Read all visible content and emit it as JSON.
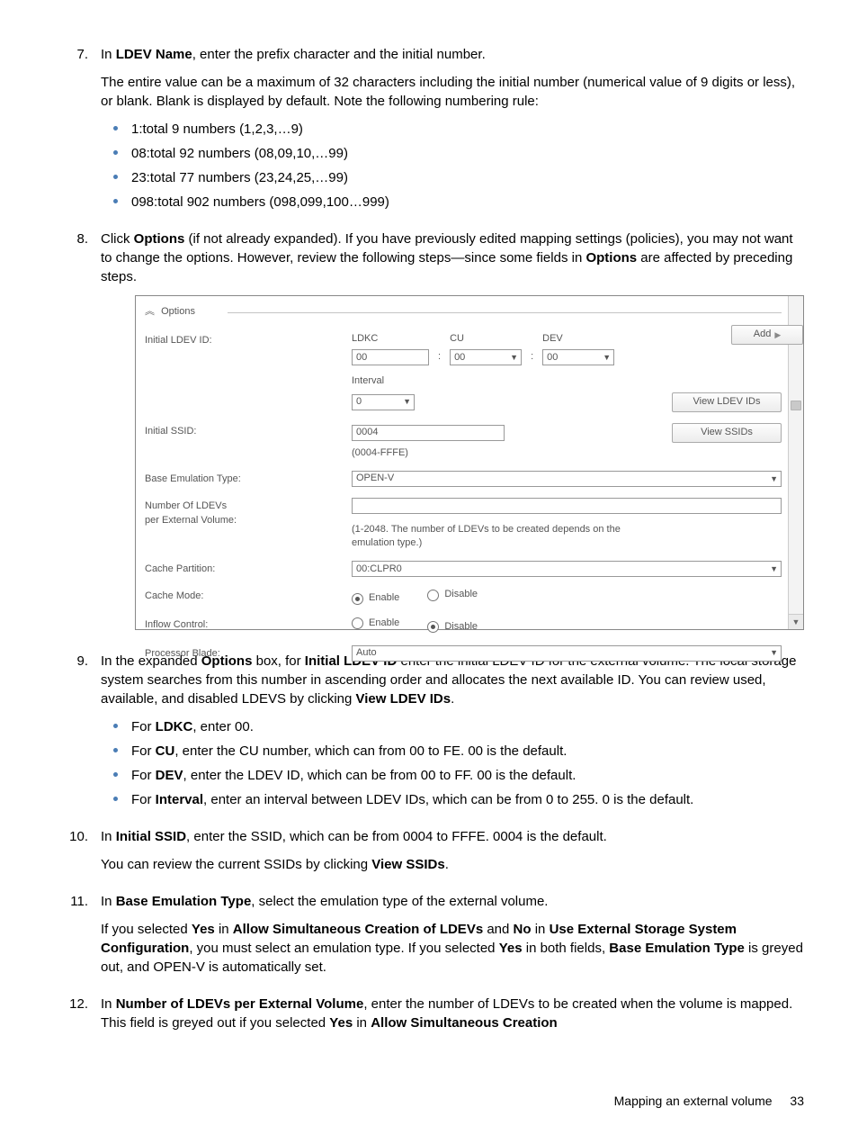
{
  "steps": {
    "s7": {
      "num": "7.",
      "intro_a": "In ",
      "intro_b": "LDEV Name",
      "intro_c": ", enter the prefix character and the initial number.",
      "para": "The entire value can be a maximum of 32 characters including the initial number (numerical value of 9 digits or less), or blank. Blank is displayed by default. Note the following numbering rule:",
      "bul": [
        "1:total 9 numbers (1,2,3,…9)",
        "08:total 92 numbers (08,09,10,…99)",
        "23:total 77 numbers (23,24,25,…99)",
        "098:total 902 numbers (098,099,100…999)"
      ]
    },
    "s8": {
      "num": "8.",
      "t1": "Click ",
      "t2": "Options",
      "t3": " (if not already expanded). If you have previously edited mapping settings (policies), you may not want to change the options. However, review the following steps—since some fields in ",
      "t4": "Options",
      "t5": " are affected by preceding steps."
    },
    "s9": {
      "num": "9.",
      "t1": "In the expanded ",
      "t2": "Options",
      "t3": " box, for ",
      "t4": "Initial LDEV ID",
      "t5": " enter the initial LDEV ID for the external volume. The local storage system searches from this number in ascending order and allocates the next available ID. You can review used, available, and disabled LDEVS by clicking ",
      "t6": "View LDEV IDs",
      "t7": ".",
      "bul": {
        "b1a": "For ",
        "b1b": "LDKC",
        "b1c": ", enter 00.",
        "b2a": "For ",
        "b2b": "CU",
        "b2c": ", enter the CU number, which can from 00 to FE. 00 is the default.",
        "b3a": "For ",
        "b3b": "DEV",
        "b3c": ", enter the LDEV ID, which can be from 00 to FF. 00 is the default.",
        "b4a": "For ",
        "b4b": "Interval",
        "b4c": ", enter an interval between LDEV IDs, which can be from 0 to 255. 0 is the default."
      }
    },
    "s10": {
      "num": "10.",
      "t1": "In ",
      "t2": "Initial SSID",
      "t3": ", enter the SSID, which can be from 0004 to FFFE. 0004 is the default.",
      "p2a": "You can review the current SSIDs by clicking ",
      "p2b": "View SSIDs",
      "p2c": "."
    },
    "s11": {
      "num": "11.",
      "t1": "In ",
      "t2": "Base Emulation Type",
      "t3": ", select the emulation type of the external volume.",
      "p2a": "If you selected ",
      "p2b": "Yes",
      "p2c": " in ",
      "p2d": "Allow Simultaneous Creation of LDEVs",
      "p2e": " and ",
      "p2f": "No",
      "p2g": " in ",
      "p2h": "Use External Storage System Configuration",
      "p2i": ", you must select an emulation type. If you selected ",
      "p2j": "Yes",
      "p2k": " in both fields, ",
      "p2l": "Base Emulation Type",
      "p2m": " is greyed out, and OPEN-V is automatically set."
    },
    "s12": {
      "num": "12.",
      "t1": "In ",
      "t2": "Number of LDEVs per External Volume",
      "t3": ", enter the number of LDEVs to be created when the volume is mapped. This field is greyed out if you selected ",
      "t4": "Yes",
      "t5": " in ",
      "t6": "Allow Simultaneous Creation"
    }
  },
  "ui": {
    "legend": "Options",
    "add": "Add",
    "labels": {
      "initial_ldev": "Initial LDEV ID:",
      "initial_ssid": "Initial SSID:",
      "base_emu": "Base Emulation Type:",
      "num_ldevs_1": "Number Of LDEVs",
      "num_ldevs_2": "per External Volume:",
      "cache_part": "Cache Partition:",
      "cache_mode": "Cache Mode:",
      "inflow": "Inflow Control:",
      "proc_blade": "Processor Blade:"
    },
    "cols": {
      "ldkc": "LDKC",
      "cu": "CU",
      "dev": "DEV",
      "interval": "Interval"
    },
    "vals": {
      "ldkc": "00",
      "cu": "00",
      "dev": "00",
      "interval": "0",
      "ssid": "0004",
      "ssid_range": "(0004-FFFE)",
      "emu": "OPEN-V",
      "num_hint": "(1-2048. The number of LDEVs to be created depends on the emulation type.)",
      "cache_part": "00:CLPR0",
      "proc": "Auto",
      "enable": "Enable",
      "disable": "Disable"
    },
    "btns": {
      "view_ldev": "View LDEV IDs",
      "view_ssid": "View SSIDs"
    }
  },
  "footer": {
    "title": "Mapping an external volume",
    "page": "33"
  }
}
